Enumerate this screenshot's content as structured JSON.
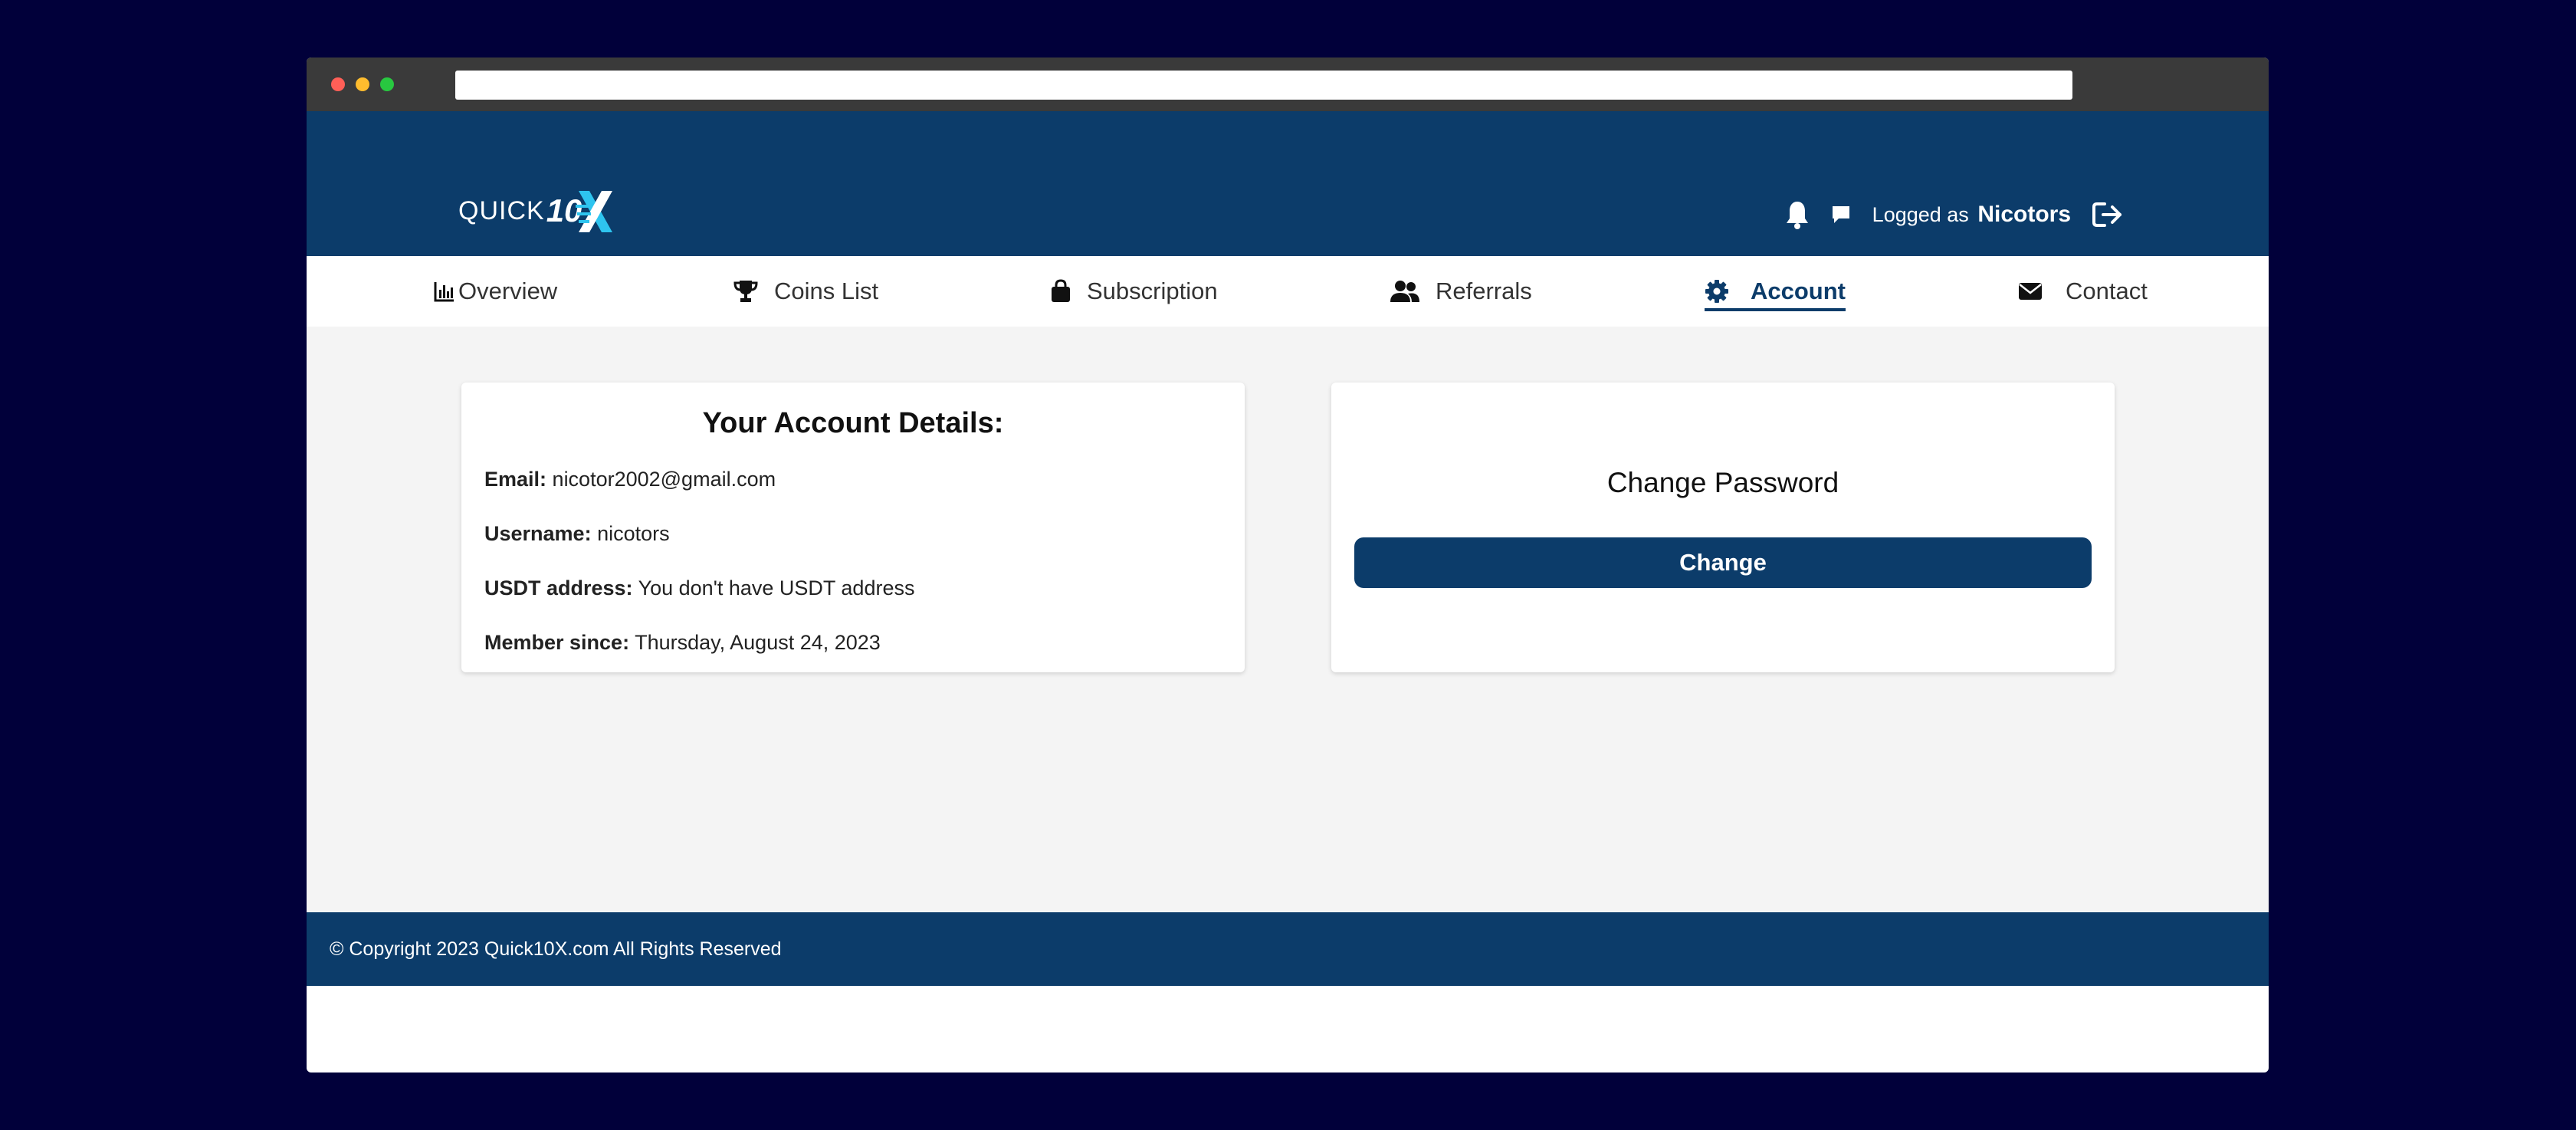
{
  "header": {
    "logo": {
      "text": "QUICK",
      "number": "10",
      "mark": "X"
    },
    "logged_prefix": "Logged as",
    "username": "Nicotors"
  },
  "nav": {
    "items": [
      {
        "label": "Overview",
        "icon": "bar-chart-icon"
      },
      {
        "label": "Coins List",
        "icon": "trophy-icon"
      },
      {
        "label": "Subscription",
        "icon": "shopping-bag-icon"
      },
      {
        "label": "Referrals",
        "icon": "users-icon"
      },
      {
        "label": "Account",
        "icon": "gear-icon",
        "active": true
      },
      {
        "label": "Contact",
        "icon": "envelope-icon"
      }
    ]
  },
  "account": {
    "title": "Your Account Details:",
    "email_label": "Email:",
    "email": "nicotor2002@gmail.com",
    "username_label": "Username:",
    "username": "nicotors",
    "usdt_label": "USDT address:",
    "usdt": "You don't have USDT address",
    "member_label": "Member since:",
    "member": "Thursday, August 24, 2023"
  },
  "password": {
    "title": "Change Password",
    "button": "Change"
  },
  "footer": {
    "text": "© Copyright 2023 Quick10X.com All Rights Reserved"
  },
  "colors": {
    "primary": "#0c3c6a",
    "page_bg": "#01003a",
    "content_bg": "#f4f4f4",
    "logo_accent": "#2ec4ef"
  }
}
